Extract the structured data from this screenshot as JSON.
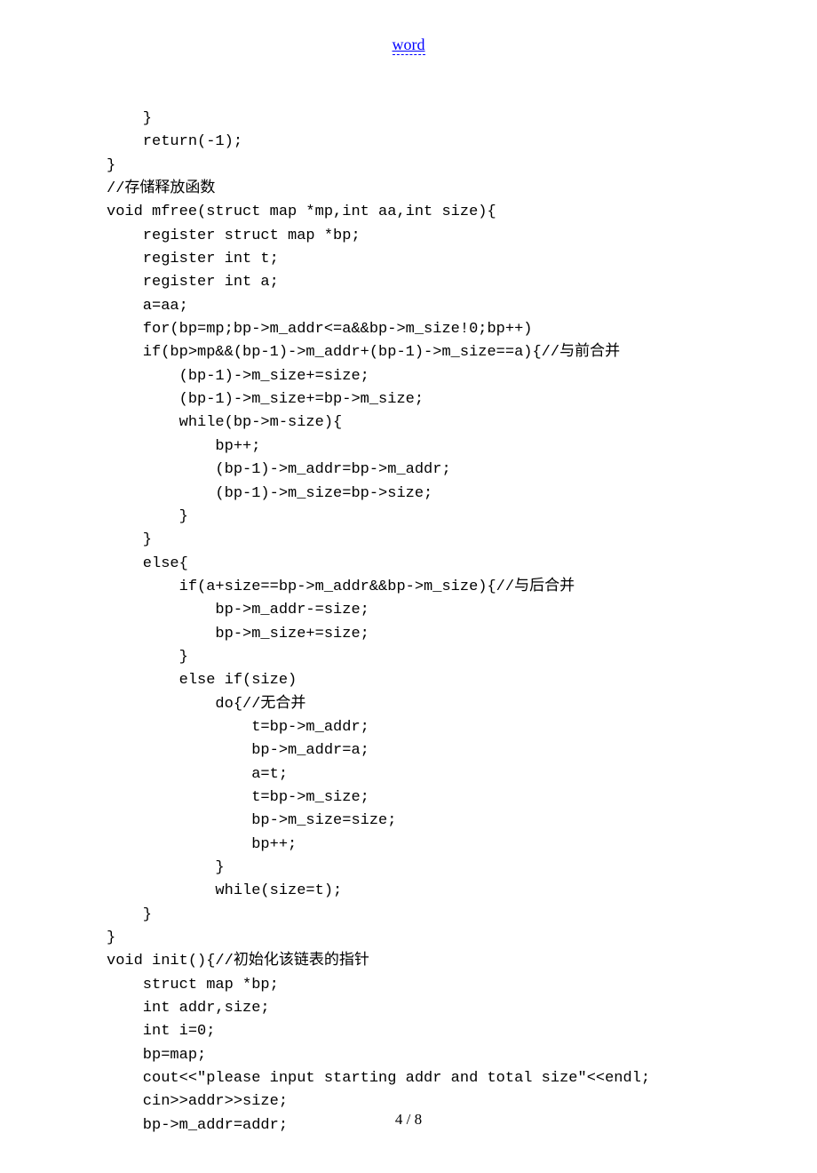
{
  "header": {
    "link_text": "word"
  },
  "code_lines": [
    "    }",
    "    return(-1);",
    "}",
    "//存储释放函数",
    "void mfree(struct map *mp,int aa,int size){",
    "    register struct map *bp;",
    "    register int t;",
    "    register int a;",
    "    a=aa;",
    "    for(bp=mp;bp->m_addr<=a&&bp->m_size!0;bp++)",
    "    if(bp>mp&&(bp-1)->m_addr+(bp-1)->m_size==a){//与前合并",
    "        (bp-1)->m_size+=size;",
    "        (bp-1)->m_size+=bp->m_size;",
    "        while(bp->m-size){",
    "            bp++;",
    "            (bp-1)->m_addr=bp->m_addr;",
    "            (bp-1)->m_size=bp->size;",
    "        }",
    "    }",
    "    else{",
    "        if(a+size==bp->m_addr&&bp->m_size){//与后合并",
    "            bp->m_addr-=size;",
    "            bp->m_size+=size;",
    "        }",
    "        else if(size)",
    "            do{//无合并",
    "                t=bp->m_addr;",
    "                bp->m_addr=a;",
    "                a=t;",
    "                t=bp->m_size;",
    "                bp->m_size=size;",
    "                bp++;",
    "            }",
    "            while(size=t);",
    "    }",
    "}",
    "void init(){//初始化该链表的指针",
    "    struct map *bp;",
    "    int addr,size;",
    "    int i=0;",
    "    bp=map;",
    "    cout<<\"please input starting addr and total size\"<<endl;",
    "    cin>>addr>>size;",
    "    bp->m_addr=addr;"
  ],
  "footer": {
    "page_info": "4 / 8"
  }
}
